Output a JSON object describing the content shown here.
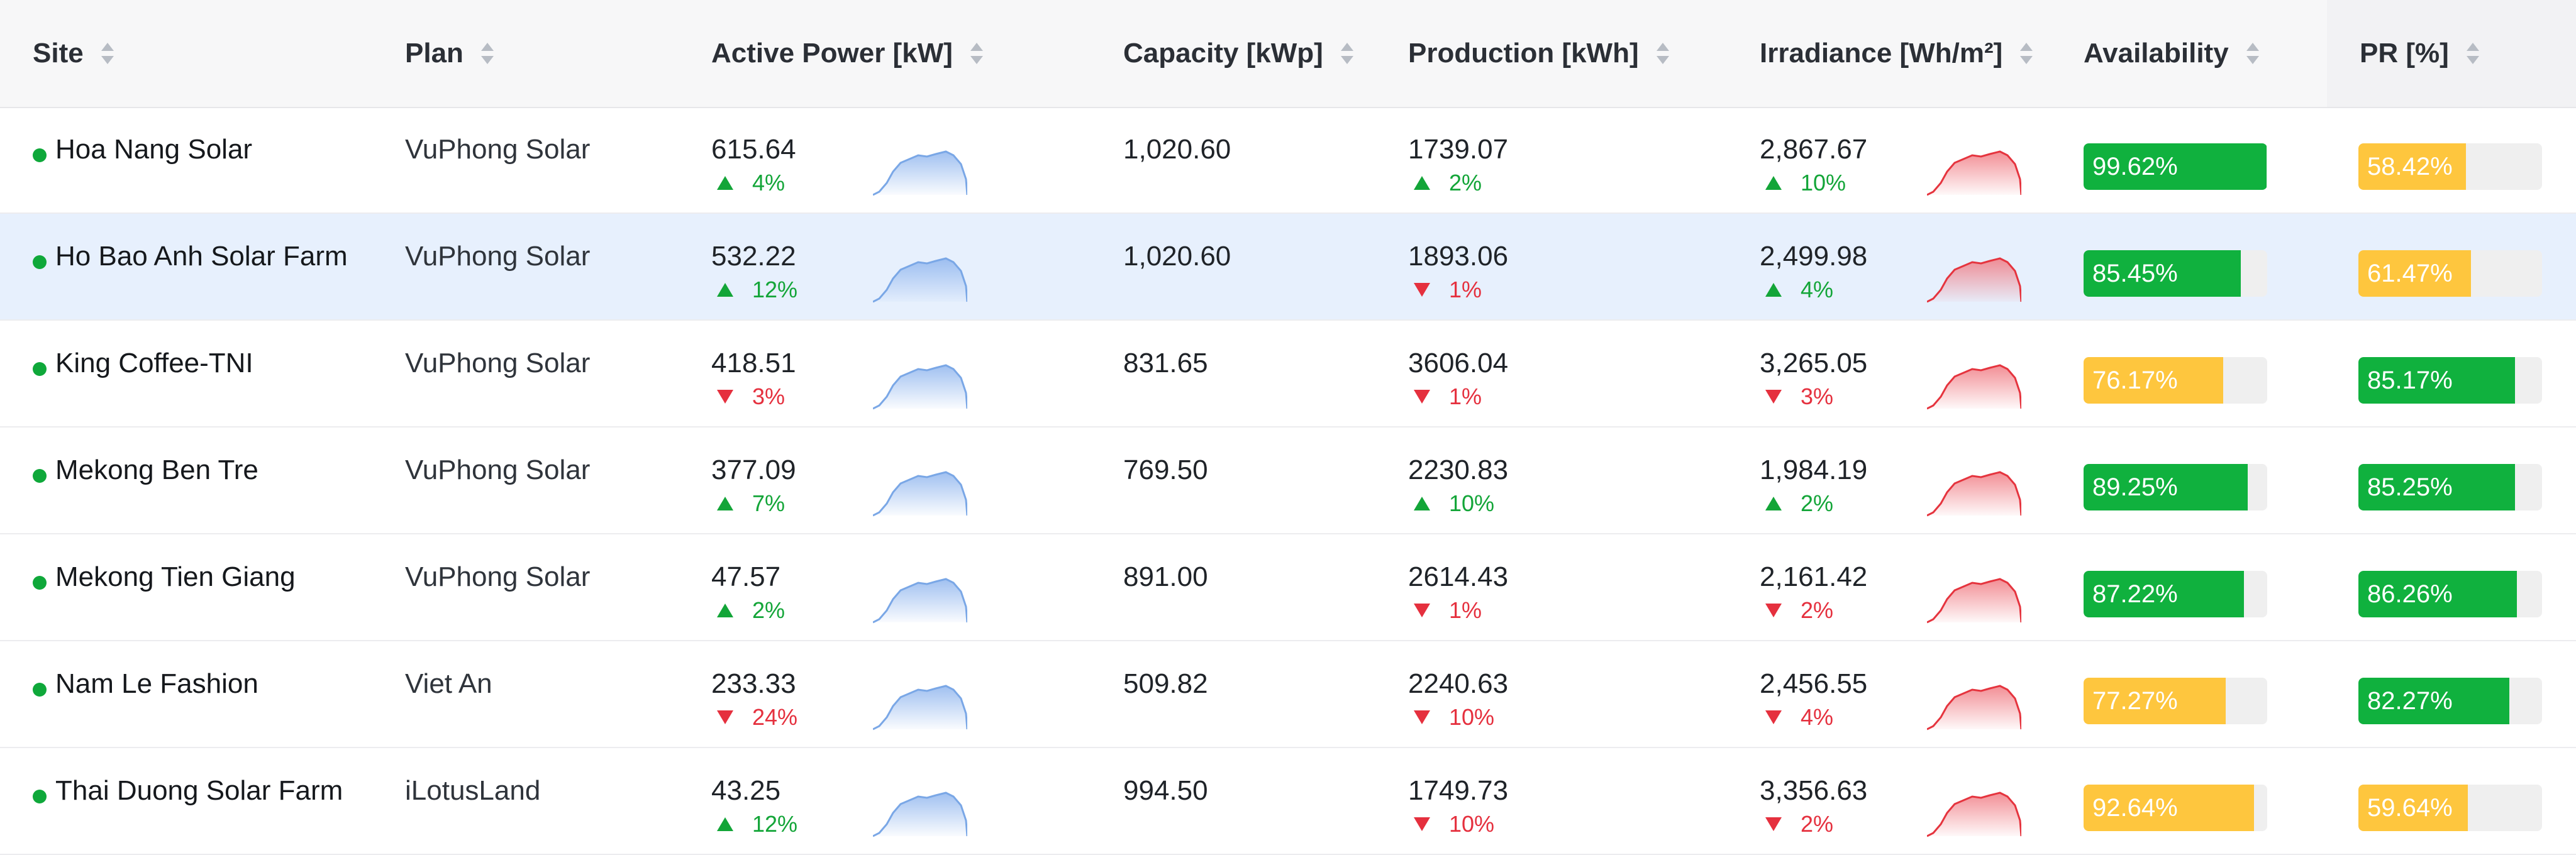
{
  "columns": [
    {
      "label": "Site"
    },
    {
      "label": "Plan"
    },
    {
      "label": "Active Power [kW]"
    },
    {
      "label": "Capacity [kWp]"
    },
    {
      "label": "Production [kWh]"
    },
    {
      "label": "Irradiance [Wh/m²]"
    },
    {
      "label": "Availability"
    },
    {
      "label": "PR [%]"
    }
  ],
  "colors": {
    "status_online": "#0fa83a",
    "up": "#13a538",
    "down": "#e5303e",
    "bar_green": "#10b13e",
    "bar_yellow": "#fec63e",
    "sparkline_power": "#7aa7e6",
    "sparkline_irradiance": "#e5343e",
    "selected_row": "#e7f0fd"
  },
  "rows": [
    {
      "site": "Hoa Nang Solar",
      "plan": "VuPhong Solar",
      "power": "615.64",
      "power_delta": "4%",
      "power_dir": "up",
      "capacity": "1,020.60",
      "production": "1739.07",
      "production_delta": "2%",
      "production_dir": "up",
      "irradiance": "2,867.67",
      "irradiance_delta": "10%",
      "irradiance_dir": "up",
      "availability": "99.62%",
      "availability_value": 99.62,
      "availability_color": "green",
      "pr": "58.42%",
      "pr_value": 58.42,
      "pr_color": "yellow",
      "selected": false
    },
    {
      "site": "Ho Bao Anh Solar Farm",
      "plan": "VuPhong Solar",
      "power": "532.22",
      "power_delta": "12%",
      "power_dir": "up",
      "capacity": "1,020.60",
      "production": "1893.06",
      "production_delta": "1%",
      "production_dir": "down",
      "irradiance": "2,499.98",
      "irradiance_delta": "4%",
      "irradiance_dir": "up",
      "availability": "85.45%",
      "availability_value": 85.45,
      "availability_color": "green",
      "pr": "61.47%",
      "pr_value": 61.47,
      "pr_color": "yellow",
      "selected": true
    },
    {
      "site": "King Coffee-TNI",
      "plan": "VuPhong Solar",
      "power": "418.51",
      "power_delta": "3%",
      "power_dir": "down",
      "capacity": "831.65",
      "production": "3606.04",
      "production_delta": "1%",
      "production_dir": "down",
      "irradiance": "3,265.05",
      "irradiance_delta": "3%",
      "irradiance_dir": "down",
      "availability": "76.17%",
      "availability_value": 76.17,
      "availability_color": "yellow",
      "pr": "85.17%",
      "pr_value": 85.17,
      "pr_color": "green",
      "selected": false
    },
    {
      "site": "Mekong Ben Tre",
      "plan": "VuPhong Solar",
      "power": "377.09",
      "power_delta": "7%",
      "power_dir": "up",
      "capacity": "769.50",
      "production": "2230.83",
      "production_delta": "10%",
      "production_dir": "up",
      "irradiance": "1,984.19",
      "irradiance_delta": "2%",
      "irradiance_dir": "up",
      "availability": "89.25%",
      "availability_value": 89.25,
      "availability_color": "green",
      "pr": "85.25%",
      "pr_value": 85.25,
      "pr_color": "green",
      "selected": false
    },
    {
      "site": "Mekong Tien Giang",
      "plan": "VuPhong Solar",
      "power": "47.57",
      "power_delta": "2%",
      "power_dir": "up",
      "capacity": "891.00",
      "production": "2614.43",
      "production_delta": "1%",
      "production_dir": "down",
      "irradiance": "2,161.42",
      "irradiance_delta": "2%",
      "irradiance_dir": "down",
      "availability": "87.22%",
      "availability_value": 87.22,
      "availability_color": "green",
      "pr": "86.26%",
      "pr_value": 86.26,
      "pr_color": "green",
      "selected": false
    },
    {
      "site": "Nam Le Fashion",
      "plan": "Viet An",
      "power": "233.33",
      "power_delta": "24%",
      "power_dir": "down",
      "capacity": "509.82",
      "production": "2240.63",
      "production_delta": "10%",
      "production_dir": "down",
      "irradiance": "2,456.55",
      "irradiance_delta": "4%",
      "irradiance_dir": "down",
      "availability": "77.27%",
      "availability_value": 77.27,
      "availability_color": "yellow",
      "pr": "82.27%",
      "pr_value": 82.27,
      "pr_color": "green",
      "selected": false
    },
    {
      "site": "Thai Duong Solar Farm",
      "plan": "iLotusLand",
      "power": "43.25",
      "power_delta": "12%",
      "power_dir": "up",
      "capacity": "994.50",
      "production": "1749.73",
      "production_delta": "10%",
      "production_dir": "down",
      "irradiance": "3,356.63",
      "irradiance_delta": "2%",
      "irradiance_dir": "down",
      "availability": "92.64%",
      "availability_value": 92.64,
      "availability_color": "yellow",
      "pr": "59.64%",
      "pr_value": 59.64,
      "pr_color": "yellow",
      "selected": false
    }
  ]
}
